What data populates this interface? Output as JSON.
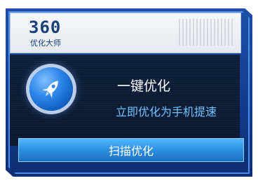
{
  "brand": {
    "number": "360",
    "subtitle": "优化大师"
  },
  "main": {
    "title": "一键优化",
    "subtitle": "立即优化为手机提速",
    "action_label": "扫描优化"
  },
  "icons": {
    "badge": "rocket-icon"
  },
  "colors": {
    "frame": "#1f4fa8",
    "body": "#0d1f3a",
    "accent": "#6fc3ff",
    "button": "#2e8fe0"
  }
}
